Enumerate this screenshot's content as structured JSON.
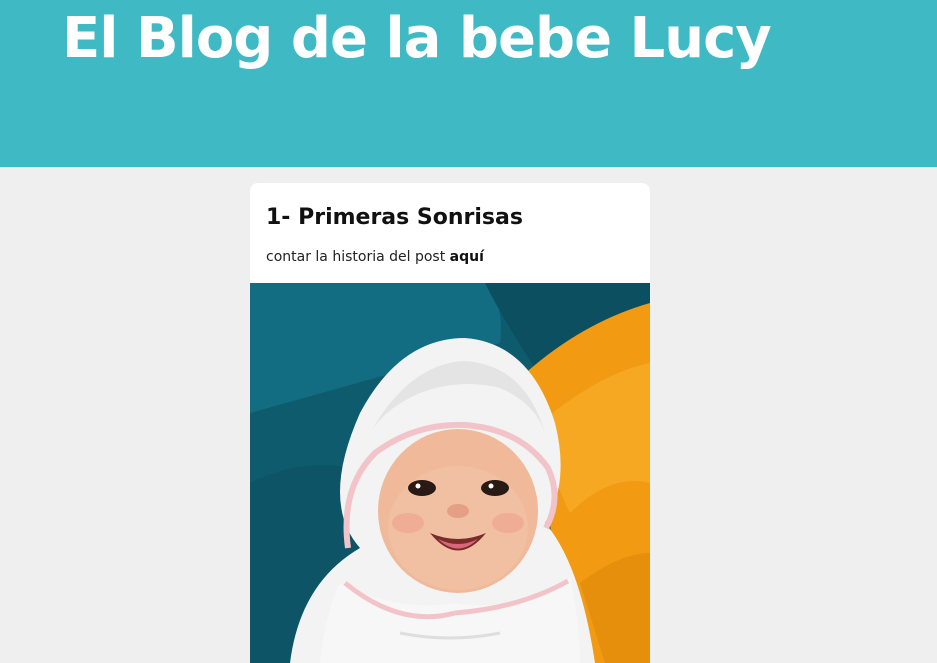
{
  "header": {
    "title": "El Blog de la bebe Lucy",
    "background_color": "#3fbac4"
  },
  "post": {
    "title": "1- Primeras Sonrisas",
    "excerpt_text": "contar la historia del post ",
    "excerpt_link": "aquí",
    "image_icon": "baby-photo"
  }
}
